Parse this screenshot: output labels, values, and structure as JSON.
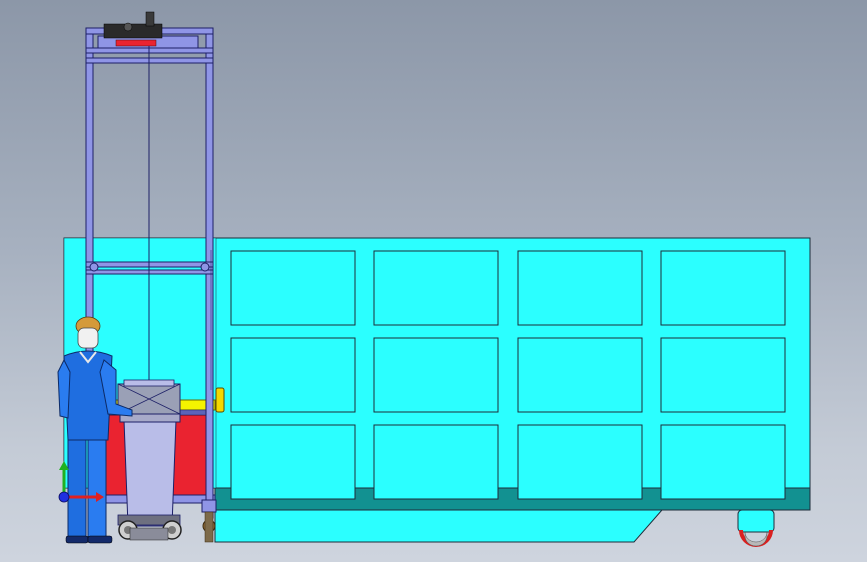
{
  "scene": {
    "description_kind": "cad-assembly-view",
    "colors": {
      "background_top": "#8c97a8",
      "background_bottom": "#ced4de",
      "container_body": "#2bffff",
      "container_outline": "#1d2c3a",
      "container_base": "#129191",
      "frame": "#8f95e6",
      "frame_outline": "#1c1f66",
      "bin_body": "#b9bde8",
      "bin_lid": "#a7aac9",
      "red_panel": "#ea2330",
      "yellow_bar": "#f4f400",
      "worker_suit": "#1f6ee0",
      "worker_face": "#f1f1f1",
      "worker_helmet": "#d49a3a",
      "wheel_tire": "#d92020"
    },
    "axis_triad": {
      "x_color": "#e02020",
      "y_color": "#21b021",
      "z_color": "#1f2fe0"
    }
  }
}
